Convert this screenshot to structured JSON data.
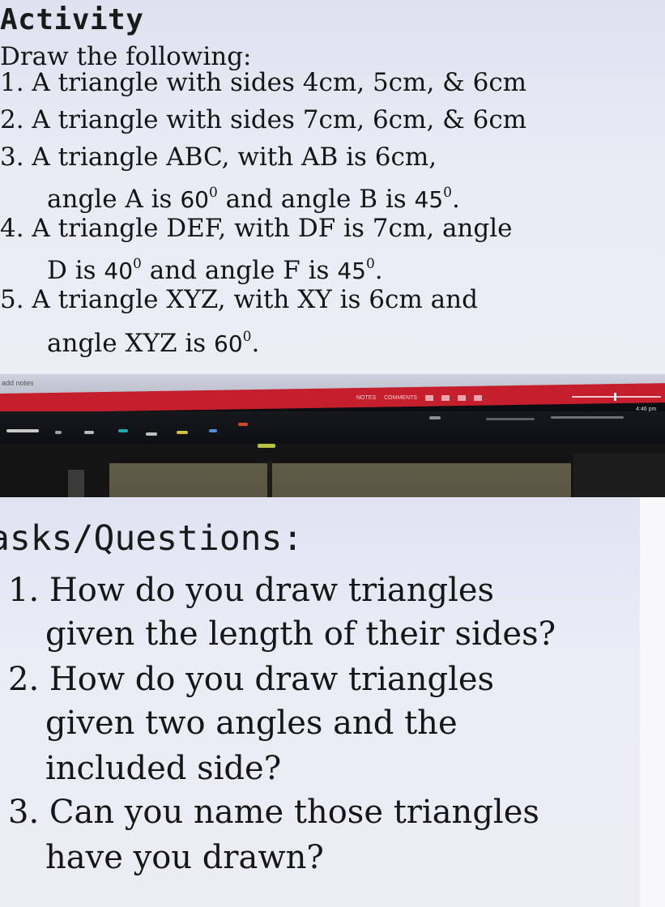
{
  "activity": {
    "title": "Activity",
    "heading": "Draw the following:",
    "items": [
      {
        "line1": "1. A triangle with sides 4cm, 5cm, & 6cm"
      },
      {
        "line1": "2. A triangle with sides 7cm, 6cm, & 6cm"
      },
      {
        "line1": "3. A triangle ABC, with AB is 6cm,",
        "line2a": "angle A is ",
        "v1": "60",
        "line2b": " and angle B is ",
        "v2": "45",
        "line2c": "."
      },
      {
        "line1": "4. A triangle DEF, with DF is 7cm, angle",
        "line2a": "D is ",
        "v1": "40",
        "line2b": " and angle F is ",
        "v2": "45",
        "line2c": "."
      },
      {
        "line1": "5. A triangle XYZ, with XY is 6cm and",
        "line2a": "angle XYZ is ",
        "v1": "60",
        "line2c": "."
      }
    ],
    "degree_mark": "0"
  },
  "window": {
    "notes_placeholder": "add notes",
    "status": {
      "notes": "NOTES",
      "comments": "COMMENTS"
    },
    "time": "4:46 pm"
  },
  "tasks": {
    "title": "asks/Questions:",
    "questions": [
      {
        "line1": "1. How do you draw triangles",
        "line2": "given the length of their sides?"
      },
      {
        "line1": "2. How do you draw triangles",
        "line2": "given two angles and the",
        "line3": "included side?"
      },
      {
        "line1": "3. Can you name those triangles",
        "line2": "have you drawn?"
      }
    ]
  },
  "colors": {
    "status_bar": "#c51f2d",
    "taskbar": "#0e0f12",
    "slide_bg": "#eaecf6"
  }
}
